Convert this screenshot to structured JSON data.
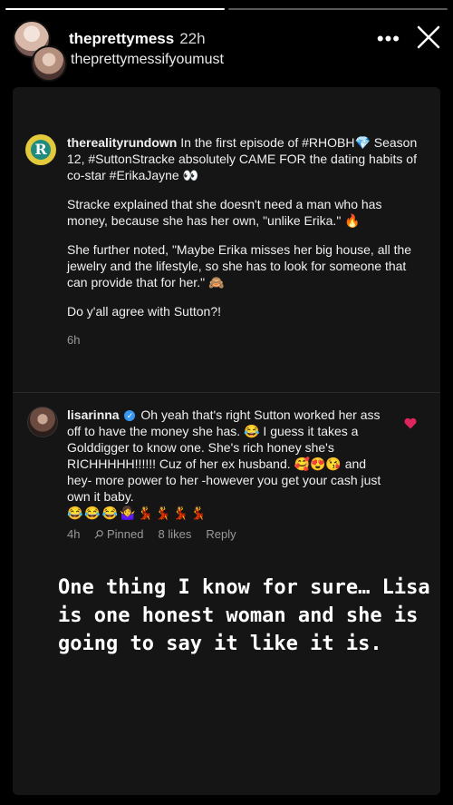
{
  "story": {
    "progress": [
      1.0,
      0.0
    ],
    "username": "theprettymess",
    "time": "22h",
    "subname": "theprettymessifyoumust",
    "more_label": "•••"
  },
  "post": {
    "logo_letter": "R",
    "username": "therealityrundown",
    "intro": "In the first episode of #RHOBH💎 Season 12, #SuttonStracke absolutely CAME FOR the dating habits of co-star #ErikaJayne 👀",
    "para2": "Stracke explained that she doesn't need a man who has money, because she has her own, \"unlike Erika.\" 🔥",
    "para3": "She further noted, \"Maybe Erika misses her big house, all the jewelry and the lifestyle, so she has to look for someone that can provide that for her.\" 🙈",
    "para4": "Do y'all agree with Sutton?!",
    "time": "6h"
  },
  "comment": {
    "username": "lisarinna",
    "verified_mark": "✓",
    "text": "Oh yeah that's right Sutton worked her ass off to have the money she has. 😂 I guess it takes a Golddigger to know one. She's rich honey she's RICHHHHH!!!!!! Cuz of her ex husband. 🥰😍😘 and hey- more power to her -however you get your cash just own it baby.",
    "emojis": "😂😂😂🤷‍♀️💃💃💃💃",
    "time": "4h",
    "pinned": "Pinned",
    "likes": "8 likes",
    "reply": "Reply"
  },
  "caption": "One thing I know for sure… Lisa is one honest woman and she is going to say it like it is.",
  "colors": {
    "heart": "#e0245e",
    "verified": "#3897f0",
    "card_bg": "#151515"
  }
}
